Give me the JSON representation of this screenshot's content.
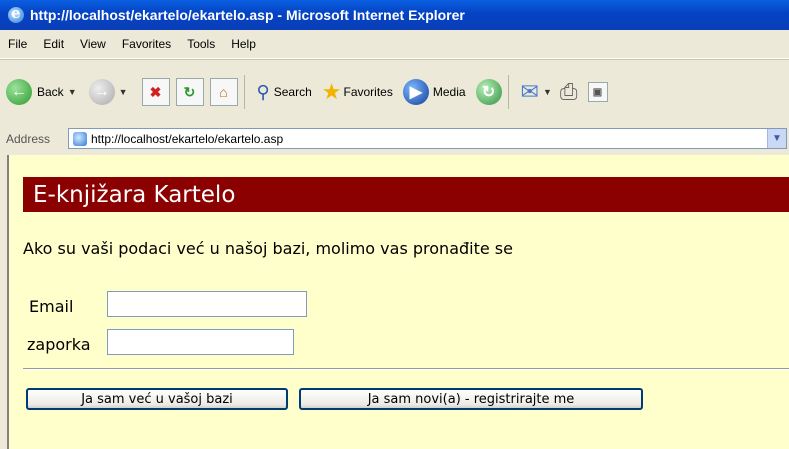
{
  "window": {
    "title": "http://localhost/ekartelo/ekartelo.asp - Microsoft Internet Explorer"
  },
  "menu": [
    "File",
    "Edit",
    "View",
    "Favorites",
    "Tools",
    "Help"
  ],
  "toolbar": {
    "back": "Back",
    "search": "Search",
    "favorites": "Favorites",
    "media": "Media"
  },
  "address": {
    "label": "Address",
    "url": "http://localhost/ekartelo/ekartelo.asp"
  },
  "page": {
    "banner": "E-knjižara Kartelo",
    "intro": "Ako su vaši podaci već u našoj bazi, molimo vas pronađite se",
    "email_label": "Email",
    "password_label": "zaporka",
    "email_value": "",
    "password_value": "",
    "existing_button": "Ja sam već u vašoj bazi",
    "new_button": "Ja sam novi(a) - registrirajte me"
  }
}
